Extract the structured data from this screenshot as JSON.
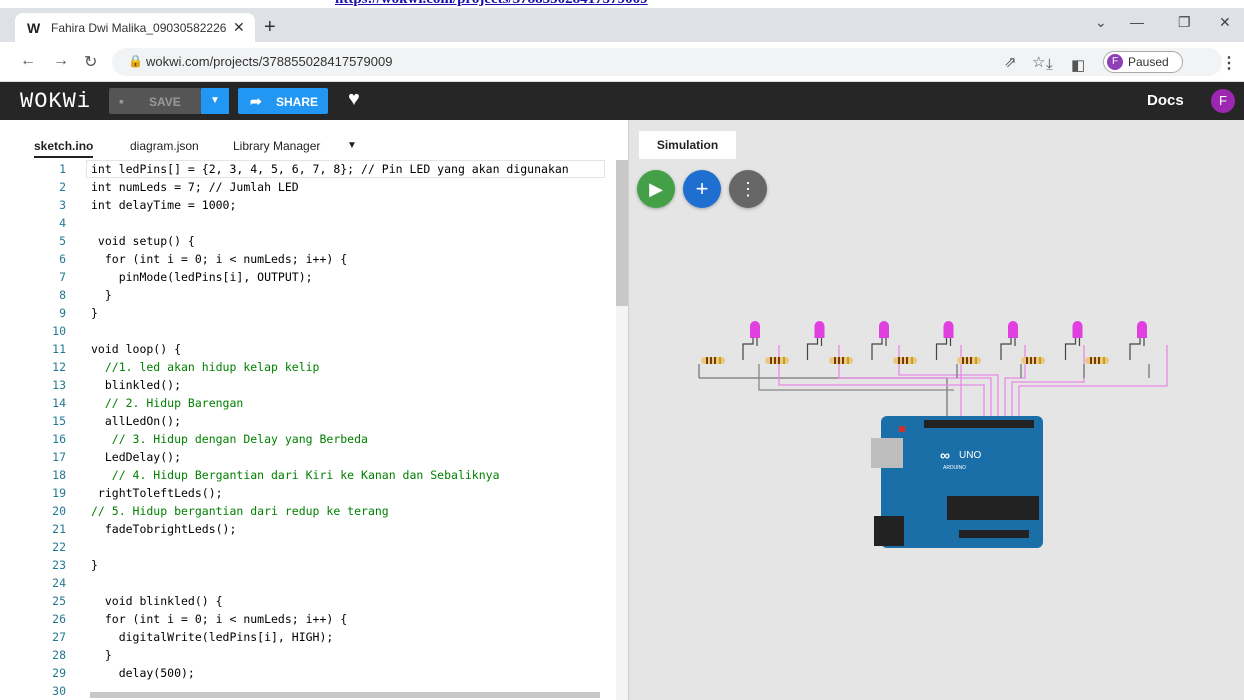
{
  "top_link": "https://wokwi.com/projects/378855028417579009",
  "browser": {
    "tab_title": "Fahira Dwi Malika_09030582226",
    "favicon": "W",
    "new_tab": "+",
    "url": "wokwi.com/projects/378855028417579009",
    "profile_initial": "F",
    "profile_status": "Paused"
  },
  "wokwi": {
    "logo": "WOKWi",
    "save_label": "SAVE",
    "share_label": "SHARE",
    "docs_label": "Docs",
    "user_initial": "F"
  },
  "editor": {
    "tabs": [
      "sketch.ino",
      "diagram.json",
      "Library Manager"
    ],
    "active_tab": "sketch.ino",
    "lines": [
      "int ledPins[] = {2, 3, 4, 5, 6, 7, 8}; // Pin LED yang akan digunakan",
      "int numLeds = 7; // Jumlah LED",
      "int delayTime = 1000;",
      "",
      " void setup() {",
      "  for (int i = 0; i < numLeds; i++) {",
      "    pinMode(ledPins[i], OUTPUT);",
      "  }",
      "}",
      "",
      "void loop() {",
      "  //1. led akan hidup kelap kelip",
      "  blinkled();",
      "  // 2. Hidup Barengan",
      "  allLedOn();",
      "   // 3. Hidup dengan Delay yang Berbeda",
      "  LedDelay();",
      "   // 4. Hidup Bergantian dari Kiri ke Kanan dan Sebaliknya",
      " rightToleftLeds();",
      "// 5. Hidup bergantian dari redup ke terang",
      "  fadeTobrightLeds();",
      "",
      "}",
      "",
      "  void blinkled() {",
      "  for (int i = 0; i < numLeds; i++) {",
      "    digitalWrite(ledPins[i], HIGH);",
      "  }",
      "    delay(500);",
      ""
    ]
  },
  "simulation": {
    "tab_label": "Simulation",
    "board_label": "UNO",
    "brand": "ARDUINO",
    "led_count": 7,
    "led_color": "#e040e0"
  },
  "colors": {
    "tab_bar": "#dee1e6",
    "wokwi_bar": "#262626",
    "share_blue": "#2196f3",
    "board_blue": "#1b6fa8",
    "run_green": "#43a047",
    "add_blue": "#1e6fd0"
  }
}
